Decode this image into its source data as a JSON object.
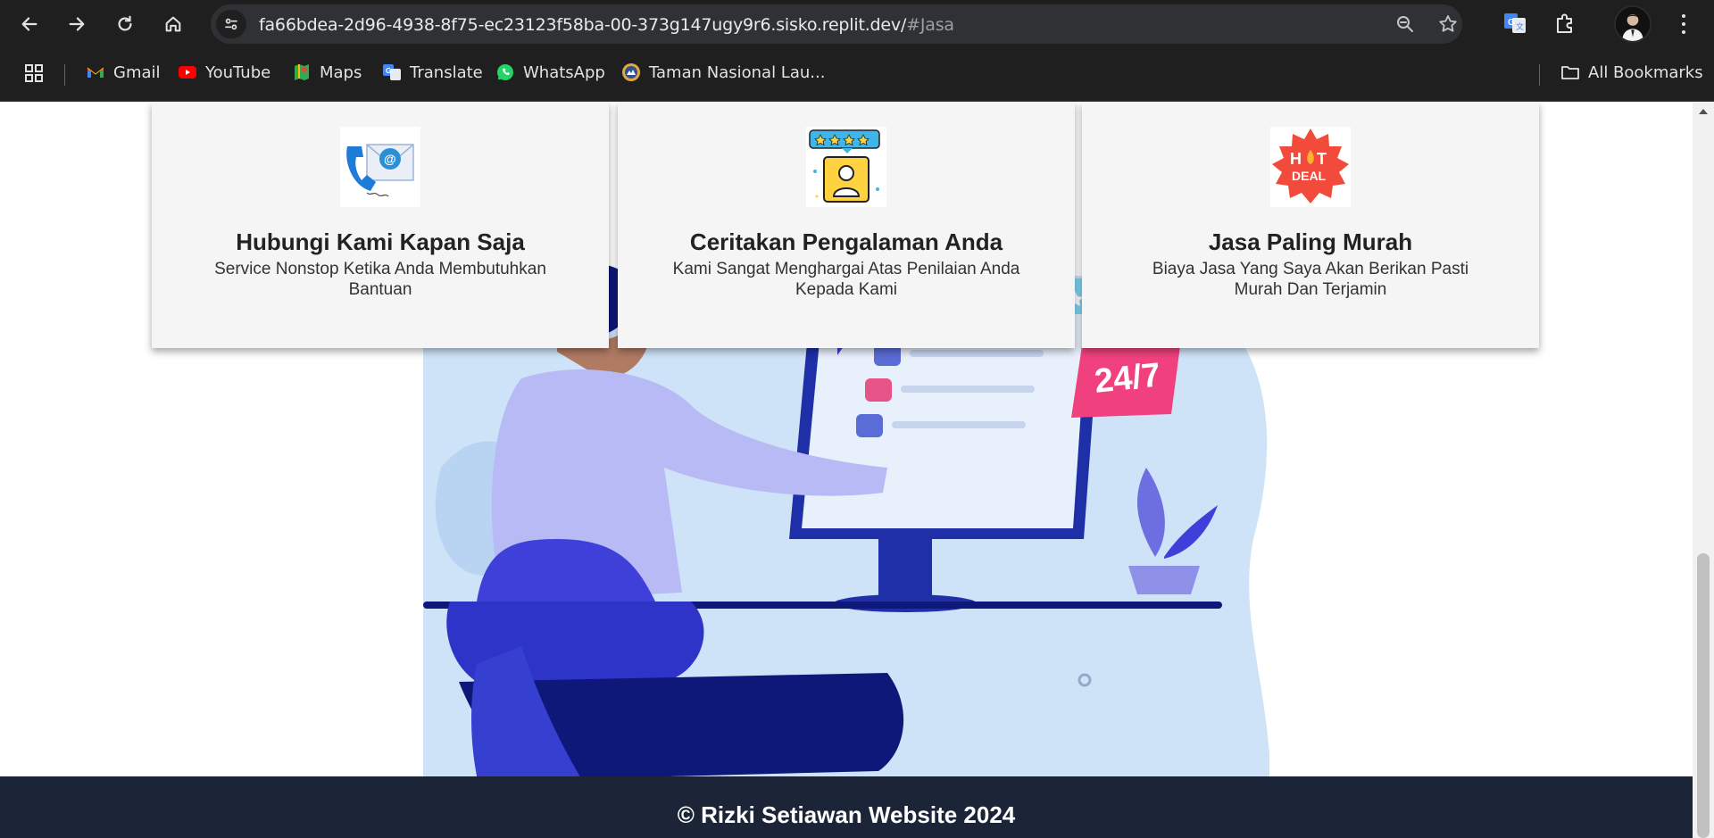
{
  "browser": {
    "url_main": "fa66bdea-2d96-4938-8f75-ec23123f58ba-00-373g147ugy9r6.sisko.replit.dev/",
    "url_fragment": "#Jasa",
    "bookmarks": [
      {
        "label": "Gmail",
        "icon": "gmail-icon"
      },
      {
        "label": "YouTube",
        "icon": "youtube-icon"
      },
      {
        "label": "Maps",
        "icon": "maps-icon"
      },
      {
        "label": "Translate",
        "icon": "translate-icon"
      },
      {
        "label": "WhatsApp",
        "icon": "whatsapp-icon"
      },
      {
        "label": "Taman Nasional Lau...",
        "icon": "park-icon"
      }
    ],
    "all_bookmarks_label": "All Bookmarks"
  },
  "cards": [
    {
      "title": "Hubungi Kami Kapan Saja",
      "desc": "Service Nonstop Ketika Anda Membutuhkan Bantuan",
      "icon": "contact-mail-icon"
    },
    {
      "title": "Ceritakan Pengalaman Anda",
      "desc": "Kami Sangat Menghargai Atas Penilaian Anda Kepada Kami",
      "icon": "rating-user-icon"
    },
    {
      "title": "Jasa Paling Murah",
      "desc": "Biaya Jasa Yang Saya Akan Berikan Pasti Murah Dan Terjamin",
      "icon": "hot-deal-icon"
    }
  ],
  "illustration": {
    "badge_text": "24/7"
  },
  "footer": {
    "text": "© Rizki Setiawan Website 2024"
  },
  "colors": {
    "chrome_bg": "#1f1f1f",
    "footer_bg": "#1c2538",
    "card_bg": "#f5f5f5",
    "illustration_accent": "#3f3fd9"
  }
}
